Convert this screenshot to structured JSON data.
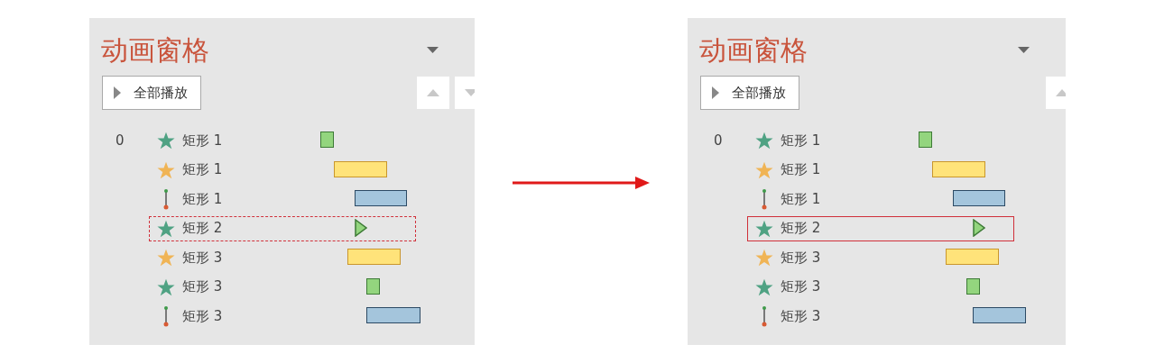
{
  "panels": [
    {
      "title": "动画窗格",
      "play_button": "全部播放",
      "scroll_buttons": [
        {
          "kind": "up"
        },
        {
          "kind": "down"
        }
      ],
      "selection": {
        "kind": "dashed"
      },
      "rows": [
        {
          "number": "0",
          "kind": "entrance",
          "label": "矩形 1",
          "marker": {
            "kind": "box"
          },
          "selected": false
        },
        {
          "kind": "emphasis",
          "label": "矩形 1",
          "marker": {
            "kind": "box"
          },
          "selected": false
        },
        {
          "kind": "motion",
          "label": "矩形 1",
          "marker": {
            "kind": "box"
          },
          "selected": false
        },
        {
          "kind": "entrance",
          "label": "矩形 2",
          "marker": {
            "kind": "triangle"
          },
          "selected": true
        },
        {
          "kind": "emphasis",
          "label": "矩形 3",
          "marker": {
            "kind": "box"
          },
          "selected": false
        },
        {
          "kind": "entrance",
          "label": "矩形 3",
          "marker": {
            "kind": "box"
          },
          "selected": false
        },
        {
          "kind": "motion",
          "label": "矩形 3",
          "marker": {
            "kind": "box"
          },
          "selected": false
        }
      ]
    },
    {
      "title": "动画窗格",
      "play_button": "全部播放",
      "scroll_buttons": [
        {
          "kind": "up"
        }
      ],
      "selection": {
        "kind": "solid"
      },
      "rows": [
        {
          "number": "0",
          "kind": "entrance",
          "label": "矩形 1",
          "marker": {
            "kind": "box"
          },
          "selected": false
        },
        {
          "kind": "emphasis",
          "label": "矩形 1",
          "marker": {
            "kind": "box"
          },
          "selected": false
        },
        {
          "kind": "motion",
          "label": "矩形 1",
          "marker": {
            "kind": "box"
          },
          "selected": false
        },
        {
          "kind": "entrance",
          "label": "矩形 2",
          "marker": {
            "kind": "triangle"
          },
          "selected": true
        },
        {
          "kind": "emphasis",
          "label": "矩形 3",
          "marker": {
            "kind": "box"
          },
          "selected": false
        },
        {
          "kind": "entrance",
          "label": "矩形 3",
          "marker": {
            "kind": "box"
          },
          "selected": false
        },
        {
          "kind": "motion",
          "label": "矩形 3",
          "marker": {
            "kind": "box"
          },
          "selected": false
        }
      ]
    }
  ]
}
